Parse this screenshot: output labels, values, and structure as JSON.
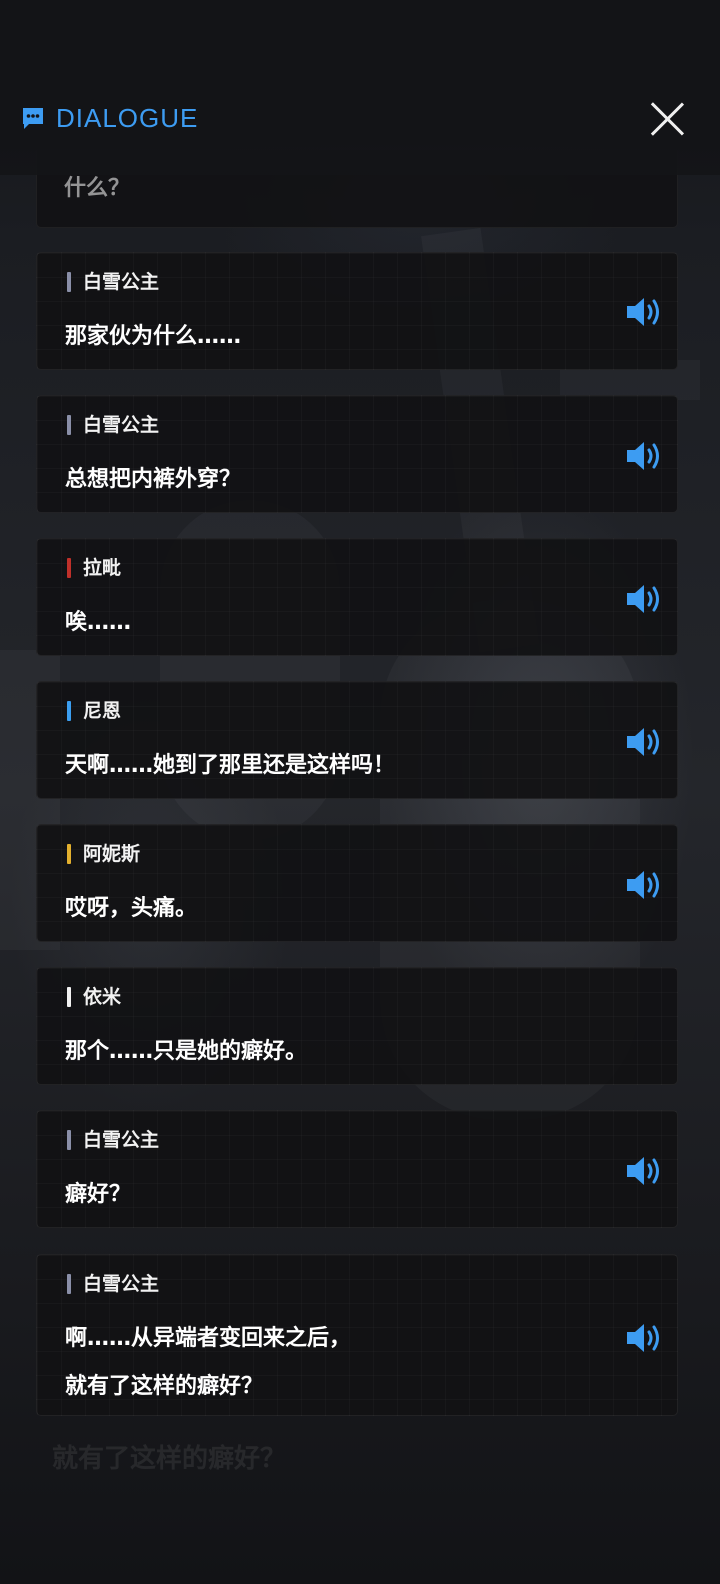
{
  "header": {
    "title": "DIALOGUE",
    "icon": "chat-bubble-icon",
    "close_icon": "close-icon"
  },
  "colors": {
    "accent": "#3d9cf2",
    "speaker_icon": "#3d9cf2"
  },
  "partial_entry": {
    "text": "什么？"
  },
  "entries": [
    {
      "speaker": "白雪公主",
      "bar_color": "#8a8fa8",
      "lines": [
        "那家伙为什么……"
      ],
      "has_voice": true
    },
    {
      "speaker": "白雪公主",
      "bar_color": "#8a8fa8",
      "lines": [
        "总想把内裤外穿？"
      ],
      "has_voice": true
    },
    {
      "speaker": "拉毗",
      "bar_color": "#c0302a",
      "lines": [
        "唉……"
      ],
      "has_voice": true
    },
    {
      "speaker": "尼恩",
      "bar_color": "#3b9ef0",
      "lines": [
        "天啊……她到了那里还是这样吗！"
      ],
      "has_voice": true
    },
    {
      "speaker": "阿妮斯",
      "bar_color": "#e3b02e",
      "lines": [
        "哎呀，头痛。"
      ],
      "has_voice": true
    },
    {
      "speaker": "依米",
      "bar_color": "#f2f2f2",
      "lines": [
        "那个……只是她的癖好。"
      ],
      "has_voice": false
    },
    {
      "speaker": "白雪公主",
      "bar_color": "#8a8fa8",
      "lines": [
        "癖好？"
      ],
      "has_voice": true
    },
    {
      "speaker": "白雪公主",
      "bar_color": "#8a8fa8",
      "lines": [
        "啊……从异端者变回来之后，",
        "就有了这样的癖好？"
      ],
      "has_voice": true
    }
  ],
  "background_caption": "就有了这样的癖好？"
}
